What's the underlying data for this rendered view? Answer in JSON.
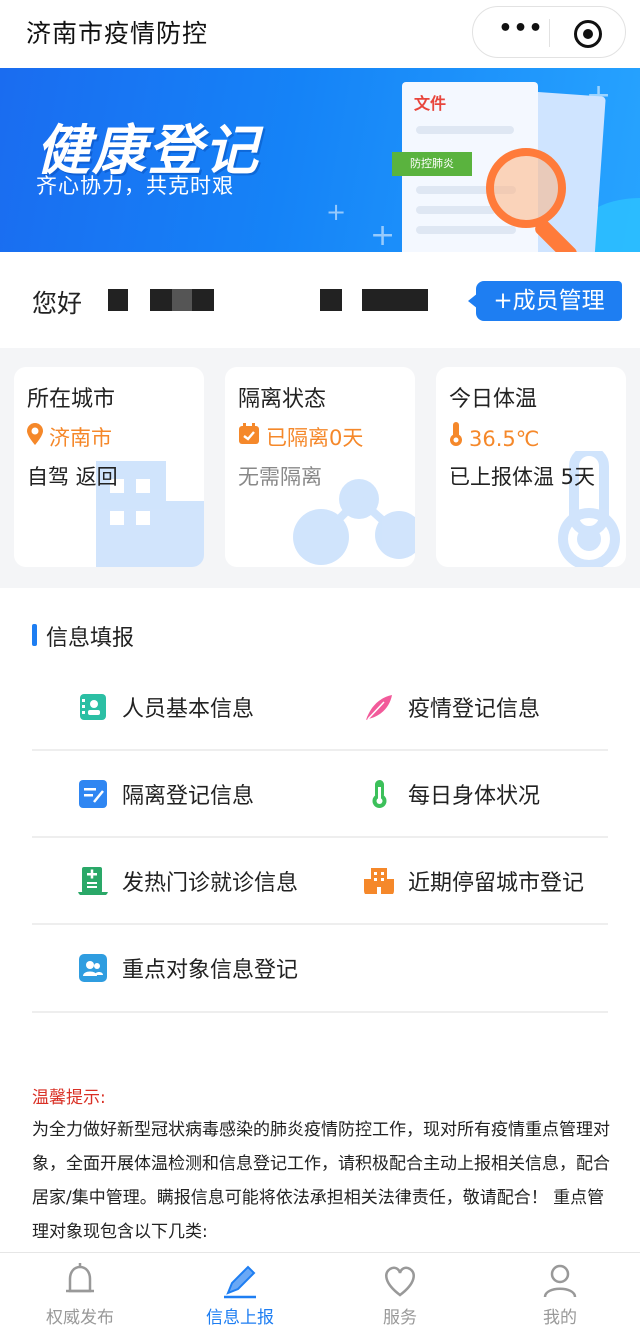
{
  "header": {
    "title": "济南市疫情防控",
    "more_icon": "more-dots-icon",
    "close_icon": "target-close-icon"
  },
  "banner": {
    "title": "健康登记",
    "subtitle": "齐心协力，共克时艰",
    "doc_label": "文件",
    "doc_tag": "防控肺炎"
  },
  "greeting": {
    "hello": "您好",
    "member_button": "+成员管理"
  },
  "cards": [
    {
      "title": "所在城市",
      "icon": "location-pin-icon",
      "value": "济南市",
      "sub": "自驾 返回"
    },
    {
      "title": "隔离状态",
      "icon": "calendar-check-icon",
      "value": "已隔离0天",
      "sub": "无需隔离"
    },
    {
      "title": "今日体温",
      "icon": "thermometer-icon",
      "value": "36.5℃",
      "sub": "已上报体温 5天"
    }
  ],
  "info": {
    "section_title": "信息填报",
    "items": [
      {
        "label": "人员基本信息",
        "icon": "id-card-icon",
        "color": "#2bbfa4"
      },
      {
        "label": "疫情登记信息",
        "icon": "feather-icon",
        "color": "#f25a9a"
      },
      {
        "label": "隔离登记信息",
        "icon": "edit-form-icon",
        "color": "#2f86f2"
      },
      {
        "label": "每日身体状况",
        "icon": "thermometer-icon",
        "color": "#3cc05a"
      },
      {
        "label": "发热门诊就诊信息",
        "icon": "clinic-icon",
        "color": "#2aa868"
      },
      {
        "label": "近期停留城市登记",
        "icon": "building-icon",
        "color": "#f5882a"
      },
      {
        "label": "重点对象信息登记",
        "icon": "users-badge-icon",
        "color": "#2f9de0"
      }
    ]
  },
  "notice": {
    "title": "温馨提示:",
    "body": "为全力做好新型冠状病毒感染的肺炎疫情防控工作，现对所有疫情重点管理对象，全面开展体温检测和信息登记工作，请积极配合主动上报相关信息，配合居家/集中管理。瞒报信息可能将依法承担相关法律责任，敬请配合！ 重点管理对象现包含以下几类:"
  },
  "tabs": [
    {
      "label": "权威发布",
      "icon": "bell-icon",
      "active": false
    },
    {
      "label": "信息上报",
      "icon": "pen-icon",
      "active": true
    },
    {
      "label": "服务",
      "icon": "heart-icon",
      "active": false
    },
    {
      "label": "我的",
      "icon": "user-icon",
      "active": false
    }
  ],
  "colors": {
    "primary": "#1e7ef2",
    "accent": "#f5882a",
    "warning": "#d93025"
  }
}
